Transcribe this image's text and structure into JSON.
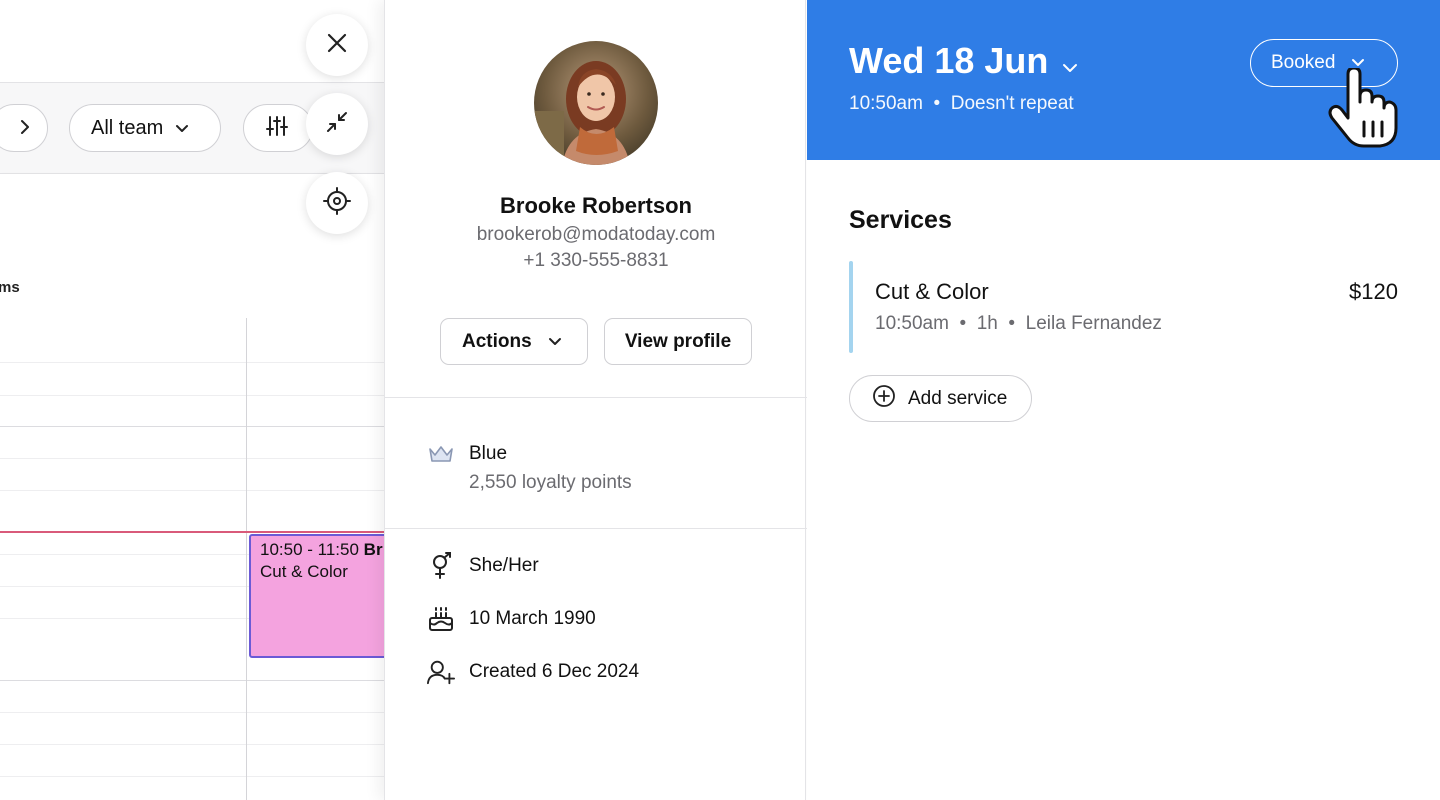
{
  "calendar": {
    "team_filter": "All team",
    "column_label": "ms",
    "appointment": {
      "time": "10:50 - 11:50",
      "client_short": "Br",
      "service": "Cut & Color"
    }
  },
  "client": {
    "name": "Brooke Robertson",
    "email": "brookerob@modatoday.com",
    "phone": "+1 330-555-8831",
    "actions_label": "Actions",
    "view_profile_label": "View profile",
    "loyalty": {
      "tier": "Blue",
      "points": "2,550 loyalty points"
    },
    "pronouns": "She/Her",
    "birthday": "10 March 1990",
    "created": "Created 6 Dec 2024"
  },
  "appointment": {
    "date": "Wed 18 Jun",
    "time": "10:50am",
    "repeat": "Doesn't repeat",
    "status": "Booked",
    "services_title": "Services",
    "services": [
      {
        "name": "Cut & Color",
        "price": "$120",
        "time": "10:50am",
        "duration": "1h",
        "staff": "Leila Fernandez"
      }
    ],
    "add_service_label": "Add service"
  },
  "colors": {
    "header_blue": "#2f7de6",
    "appointment_pink": "#f4a3df",
    "appointment_border": "#6b5ad6",
    "service_bar": "#a4d4ef",
    "now_line": "#d95a7a"
  }
}
